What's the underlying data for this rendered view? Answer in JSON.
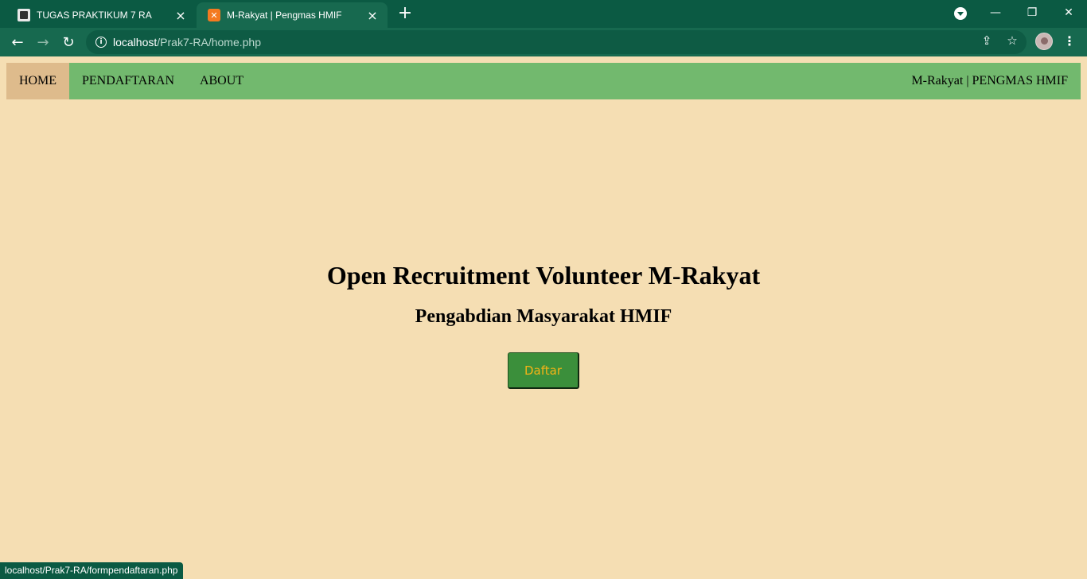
{
  "browser": {
    "tabs": [
      {
        "title": "TUGAS PRAKTIKUM 7 RA",
        "close": "×"
      },
      {
        "title": "M-Rakyat | Pengmas HMIF",
        "close": "×"
      }
    ],
    "new_tab": "+",
    "window_controls": {
      "minimize": "—",
      "restore": "❐",
      "close": "✕"
    },
    "url": {
      "host": "localhost",
      "path": "/Prak7-RA/home.php"
    },
    "icons": {
      "back": "←",
      "forward": "→",
      "reload": "↻",
      "share": "⇪",
      "bookmark": "☆",
      "menu": "⋮",
      "info": "i"
    },
    "status_url": "localhost/Prak7-RA/formpendaftaran.php"
  },
  "nav": {
    "items": [
      {
        "label": "HOME",
        "active": true
      },
      {
        "label": "PENDAFTARAN",
        "active": false
      },
      {
        "label": "ABOUT",
        "active": false
      }
    ],
    "brand": "M-Rakyat | PENGMAS HMIF"
  },
  "hero": {
    "title": "Open Recruitment Volunteer M-Rakyat",
    "subtitle": "Pengabdian Masyarakat HMIF",
    "button": "Daftar"
  },
  "colors": {
    "page_bg": "#f5deb3",
    "navbar_bg": "#72b96e",
    "nav_active_bg": "#debb8c",
    "button_bg": "#3b8f3b",
    "button_text": "#f5b316",
    "chrome_dark": "#0b5a43",
    "chrome_toolbar": "#17694f"
  }
}
